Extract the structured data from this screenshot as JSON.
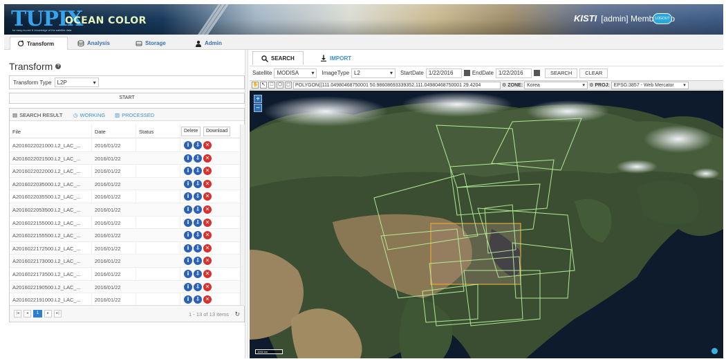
{
  "header": {
    "logo_main": "TUPIX",
    "logo_sub": "OCEAN COLOR",
    "logo_tag": "for easy-to-use & knowledge of the satellite data",
    "org": "KISTI",
    "user": "[admin] MemberInfo",
    "pill": "LOGOUT"
  },
  "nav": {
    "tabs": [
      {
        "label": "Transform",
        "icon": "refresh-icon",
        "active": true
      },
      {
        "label": "Analysis",
        "icon": "database-icon",
        "active": false
      },
      {
        "label": "Storage",
        "icon": "hdd-icon",
        "active": false
      },
      {
        "label": "Admin",
        "icon": "user-icon",
        "active": false
      }
    ]
  },
  "left": {
    "title": "Transform",
    "type_label": "Transform Type",
    "type_value": "L2P",
    "start_label": "START",
    "grid_tabs": [
      "SEARCH RESULT",
      "WORKING",
      "PROCESSED"
    ],
    "columns": {
      "file": "File",
      "date": "Date",
      "status": "Status",
      "delete": "Delete",
      "download": "Download"
    },
    "rows": [
      {
        "file": "A2016022021000.L2_LAC_...",
        "date": "2016/01/22"
      },
      {
        "file": "A2016022021500.L2_LAC_...",
        "date": "2016/01/22"
      },
      {
        "file": "A2016022022000.L2_LAC_...",
        "date": "2016/01/22"
      },
      {
        "file": "A2016022035000.L2_LAC_...",
        "date": "2016/01/22"
      },
      {
        "file": "A2016022035500.L2_LAC_...",
        "date": "2016/01/22"
      },
      {
        "file": "A2016022053500.L2_LAC_...",
        "date": "2016/01/22"
      },
      {
        "file": "A2016022155000.L2_LAC_...",
        "date": "2016/01/22"
      },
      {
        "file": "A2016022155500.L2_LAC_...",
        "date": "2016/01/22"
      },
      {
        "file": "A2016022172500.L2_LAC_...",
        "date": "2016/01/22"
      },
      {
        "file": "A2016022173000.L2_LAC_...",
        "date": "2016/01/22"
      },
      {
        "file": "A2016022173500.L2_LAC_...",
        "date": "2016/01/22"
      },
      {
        "file": "A2016022190500.L2_LAC_...",
        "date": "2016/01/22"
      },
      {
        "file": "A2016022191000.L2_LAC_...",
        "date": "2016/01/22"
      }
    ],
    "pager": {
      "current": "1",
      "info": "1 - 13 of 13 items"
    }
  },
  "right": {
    "tabs": [
      {
        "label": "SEARCH",
        "icon": "search-icon",
        "active": true
      },
      {
        "label": "IMPORT",
        "icon": "import-icon",
        "active": false
      }
    ],
    "filters": {
      "satellite_label": "Satellite",
      "satellite_value": "MODISA",
      "imagetype_label": "ImageType",
      "imagetype_value": "L2",
      "startdate_label": "StartDate",
      "startdate_value": "1/22/2016",
      "enddate_label": "EndDate",
      "enddate_value": "1/22/2016",
      "search_btn": "SEARCH",
      "clear_btn": "CLEAR"
    },
    "toolbar": {
      "polygon": "POLYGON((111.04980468750001 50.98608693339352,111.04980468750001 29.4204",
      "zone_label": "ZONE:",
      "zone_value": "Korea",
      "proj_label": "PROJ:",
      "proj_value": "EPSG:3857 - Web Mercator"
    },
    "map": {
      "zoom_in": "+",
      "zoom_out": "−",
      "scale": "1000 km"
    }
  },
  "colors": {
    "accent": "#3a8fd0",
    "footprint": "#b6f39a",
    "selection": "#e0a93a"
  }
}
